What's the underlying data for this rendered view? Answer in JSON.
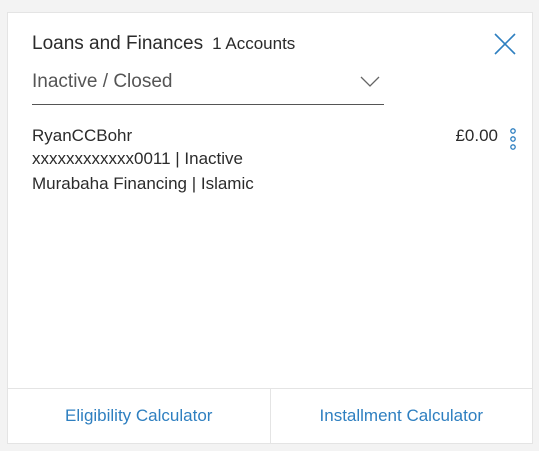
{
  "header": {
    "title": "Loans and Finances",
    "account_count": "1 Accounts"
  },
  "filter": {
    "selected": "Inactive / Closed"
  },
  "accounts": [
    {
      "name": "RyanCCBohr",
      "number_status": "xxxxxxxxxxxx0011 | Inactive",
      "product": "Murabaha Financing | Islamic",
      "balance": "£0.00"
    }
  ],
  "footer": {
    "left_label": "Eligibility Calculator",
    "right_label": "Installment Calculator"
  },
  "icons": {
    "close": "close-icon",
    "chevron": "chevron-down-icon",
    "more": "more-vertical-icon"
  },
  "colors": {
    "accent": "#2e7fc0",
    "text": "#2b2b2b",
    "muted": "#555555",
    "border": "#e4e4e4"
  }
}
